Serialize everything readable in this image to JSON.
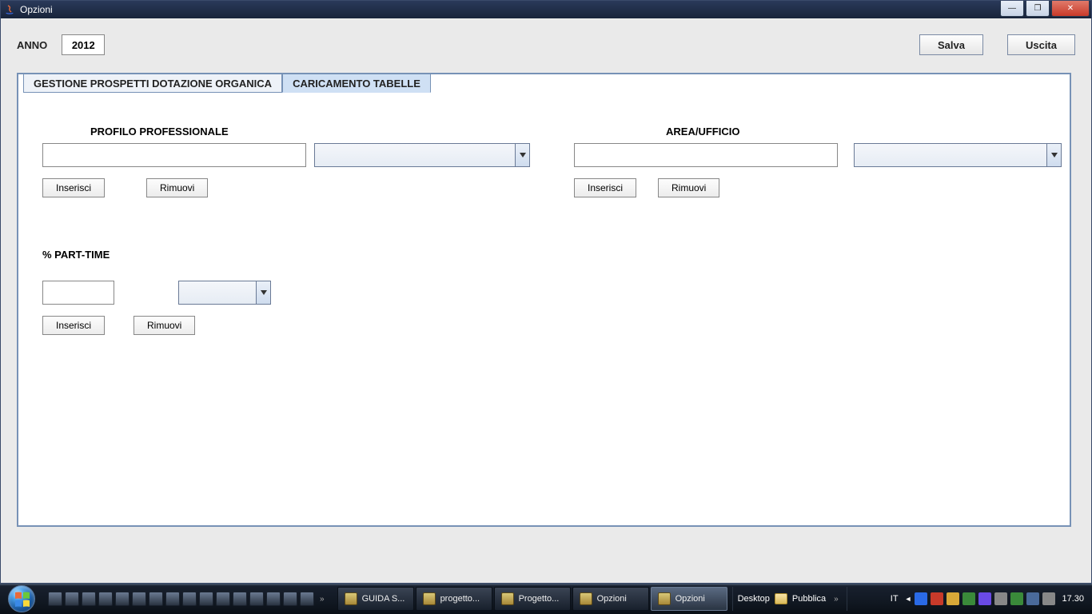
{
  "window": {
    "title": "Opzioni",
    "buttons": {
      "min": "—",
      "max": "❐",
      "close": "✕"
    }
  },
  "header": {
    "anno_label": "ANNO",
    "anno_value": "2012",
    "save_label": "Salva",
    "exit_label": "Uscita"
  },
  "tabs": {
    "t0": "GESTIONE PROSPETTI DOTAZIONE ORGANICA",
    "t1": "CARICAMENTO TABELLE"
  },
  "sections": {
    "profilo": {
      "label": "PROFILO PROFESSIONALE",
      "input": "",
      "combo": "",
      "insert": "Inserisci",
      "remove": "Rimuovi"
    },
    "area": {
      "label": "AREA/UFFICIO",
      "input": "",
      "combo": "",
      "insert": "Inserisci",
      "remove": "Rimuovi"
    },
    "parttime": {
      "label": "% PART-TIME",
      "input": "",
      "combo": "",
      "insert": "Inserisci",
      "remove": "Rimuovi"
    }
  },
  "taskbar": {
    "items": [
      {
        "label": "GUIDA S..."
      },
      {
        "label": "progetto..."
      },
      {
        "label": "Progetto..."
      },
      {
        "label": "Opzioni"
      },
      {
        "label": "Opzioni"
      }
    ],
    "desktop_label": "Desktop",
    "pubblica_label": "Pubblica",
    "lang": "IT",
    "clock": "17.30"
  }
}
